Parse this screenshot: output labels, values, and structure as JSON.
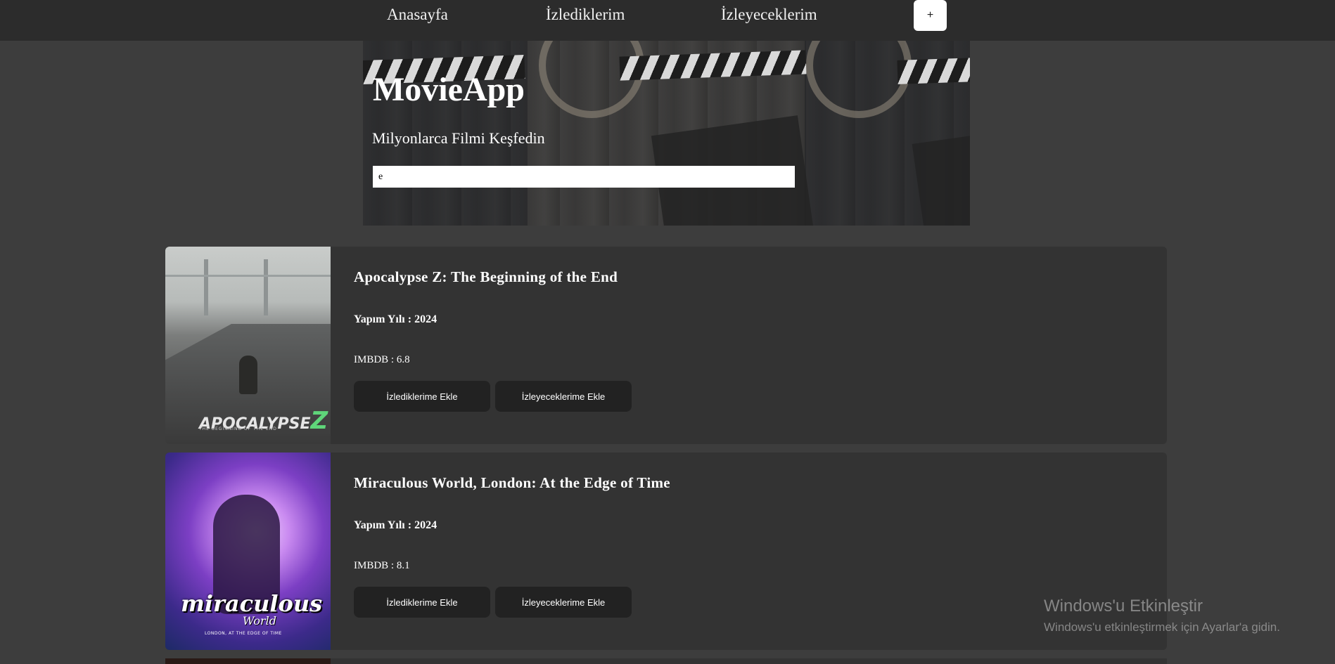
{
  "nav": {
    "links": [
      "Anasayfa",
      "İzlediklerim",
      "İzleyeceklerim"
    ],
    "add_label": "+"
  },
  "hero": {
    "title": "MovieApp",
    "subtitle": "Milyonlarca Filmi Keşfedin",
    "search_value": "e"
  },
  "movies": [
    {
      "title": "Apocalypse Z: The Beginning of the End",
      "year_text": "Yapım Yılı : 2024",
      "imdb_text": "IMBDB : 6.8",
      "poster_logo": "APOCALYPSE",
      "poster_logo_accent": "Z",
      "poster_tagline": "THE BEGINNING OF THE END"
    },
    {
      "title": "Miraculous World, London: At the Edge of Time",
      "year_text": "Yapım Yılı : 2024",
      "imdb_text": "IMBDB : 8.1",
      "poster_logo": "miraculous",
      "poster_logo_sub": "World",
      "poster_tagline": "LONDON, AT THE EDGE OF TIME"
    }
  ],
  "buttons": {
    "watched": "İzlediklerime Ekle",
    "towatch": "İzleyeceklerime Ekle"
  },
  "watermark": {
    "title": "Windows'u Etkinleştir",
    "subtitle": "Windows'u etkinleştirmek için Ayarlar'a gidin."
  },
  "colors": {
    "page_bg": "#3d3d3d",
    "nav_bg": "#2c2c2c",
    "card_bg": "#333333",
    "button_bg": "#222222",
    "accent_logo": "#5fd67a"
  }
}
